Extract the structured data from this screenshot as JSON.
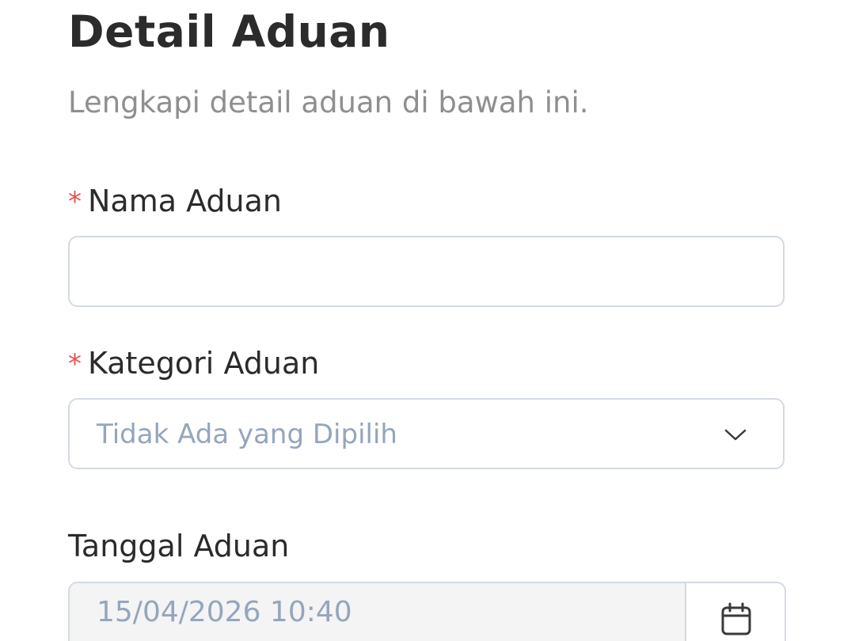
{
  "header": {
    "title": "Detail Aduan",
    "subtitle": "Lengkapi detail aduan di bawah ini."
  },
  "form": {
    "required_marker": "*",
    "nama_aduan": {
      "label": "Nama Aduan",
      "value": "",
      "required": true
    },
    "kategori_aduan": {
      "label": "Kategori Aduan",
      "selected": "Tidak Ada yang Dipilih",
      "required": true,
      "icon": "chevron-down-icon"
    },
    "tanggal_aduan": {
      "label": "Tanggal Aduan",
      "value": "15/04/2026 10:40",
      "required": false,
      "icon": "calendar-icon"
    }
  },
  "colors": {
    "required_marker": "#e0554f",
    "placeholder_text": "#94a6bc",
    "border": "#d3dae4",
    "disabled_bg": "#f4f4f4",
    "heading": "#2b2b2b",
    "subtitle": "#8f8f8f"
  }
}
